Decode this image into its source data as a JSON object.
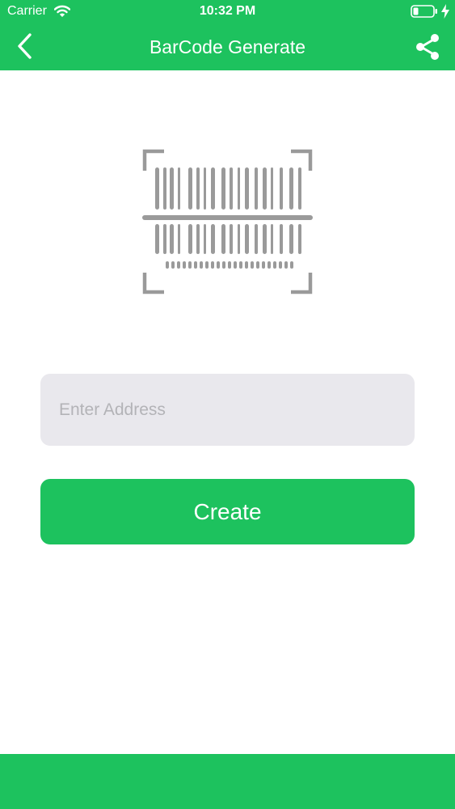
{
  "status_bar": {
    "carrier": "Carrier",
    "time": "10:32 PM"
  },
  "navbar": {
    "title": "BarCode Generate",
    "back_icon": "chevron-left-icon",
    "share_icon": "share-icon"
  },
  "main": {
    "illustration_icon": "barcode-scan-icon",
    "address_input": {
      "placeholder": "Enter Address",
      "value": ""
    },
    "create_label": "Create"
  },
  "colors": {
    "accent": "#1dc25e",
    "input_background": "#e9e8ed",
    "icon_gray": "#9a9a9a",
    "placeholder": "#b3b3b7"
  }
}
